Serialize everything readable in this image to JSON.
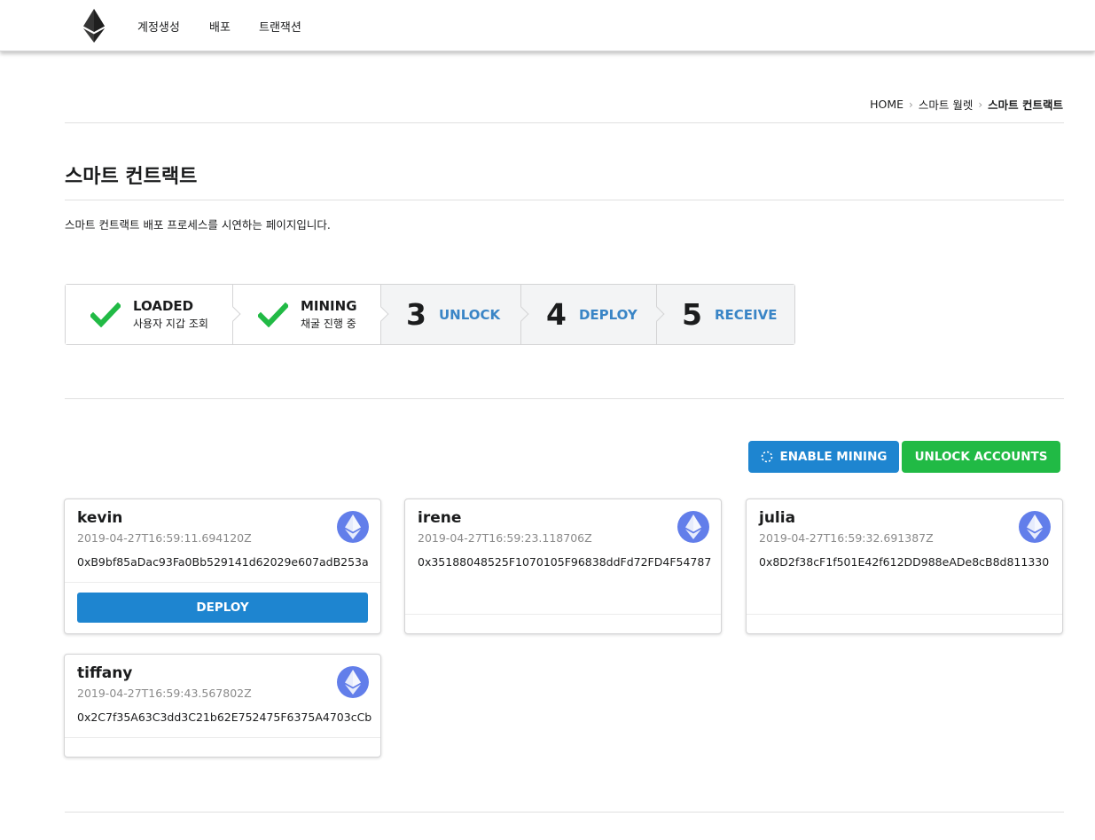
{
  "nav": {
    "items": [
      {
        "label": "계정생성"
      },
      {
        "label": "배포"
      },
      {
        "label": "트랜잭션"
      }
    ]
  },
  "breadcrumb": {
    "items": [
      "HOME",
      "스마트 월렛",
      "스마트 컨트랙트"
    ]
  },
  "page": {
    "title": "스마트 컨트랙트",
    "description": "스마트 컨트랙트 배포 프로세스를 시연하는 페이지입니다."
  },
  "steps": [
    {
      "title": "LOADED",
      "description": "사용자 지갑 조회",
      "status": "completed"
    },
    {
      "title": "MINING",
      "description": "채굴 진행 중",
      "status": "completed"
    },
    {
      "number": "3",
      "title": "UNLOCK",
      "status": "pending"
    },
    {
      "number": "4",
      "title": "DEPLOY",
      "status": "pending"
    },
    {
      "number": "5",
      "title": "RECEIVE",
      "status": "pending"
    }
  ],
  "actions": {
    "enable_mining": "ENABLE MINING",
    "unlock_accounts": "UNLOCK ACCOUNTS"
  },
  "accounts": [
    {
      "name": "kevin",
      "created": "2019-04-27T16:59:11.694120Z",
      "address": "0xB9bf85aDac93Fa0Bb529141d62029e607adB253a",
      "action": "DEPLOY"
    },
    {
      "name": "irene",
      "created": "2019-04-27T16:59:23.118706Z",
      "address": "0x35188048525F1070105F96838ddFd72FD4F54787"
    },
    {
      "name": "julia",
      "created": "2019-04-27T16:59:32.691387Z",
      "address": "0x8D2f38cF1f501E42f612DD988eADe8cB8d811330"
    },
    {
      "name": "tiffany",
      "created": "2019-04-27T16:59:43.567802Z",
      "address": "0x2C7f35A63C3dd3C21b62E752475F6375A4703cCb"
    }
  ],
  "colors": {
    "primary": "#1e85d0",
    "success": "#21ba45",
    "step_pending_text": "#3a85c6",
    "avatar": "#627eea"
  },
  "icons": {
    "logo": "ethereum-logo",
    "completed_step": "check-icon",
    "mining": "spinner-icon",
    "avatar": "ethereum-icon"
  }
}
